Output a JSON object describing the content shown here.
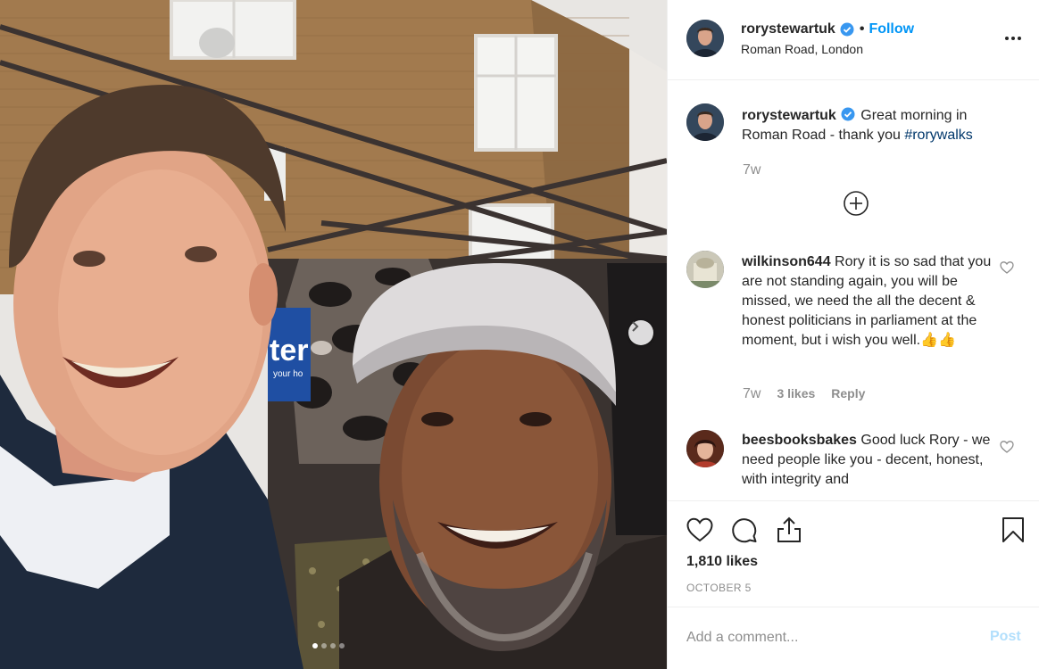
{
  "photo": {
    "alt_dots": 4,
    "active_dot": 0,
    "next_icon": "chevron-right-icon",
    "sign_text": "ter",
    "sign_subtext": "your ho"
  },
  "header": {
    "username": "rorystewartuk",
    "verified_icon": "verified-badge-icon",
    "separator": "•",
    "follow_label": "Follow",
    "location": "Roman Road, London",
    "more_icon": "more-options-icon"
  },
  "caption": {
    "username": "rorystewartuk",
    "text": " Great morning in Roman Road - thank you ",
    "hashtag": "#rorywalks",
    "time": "7w",
    "load_more_icon": "plus-circle-icon"
  },
  "comments": [
    {
      "username": "wilkinson644",
      "text": " Rory it is so sad that you are not standing again, you will be missed, we need the all the decent & honest politicians in parliament at the moment, but i wish you well.👍👍",
      "time": "7w",
      "likes": "3 likes",
      "reply": "Reply"
    },
    {
      "username": "beesbooksbakes",
      "text": " Good luck Rory - we need people like you - decent, honest, with integrity and"
    }
  ],
  "actions": {
    "like_icon": "heart-icon",
    "comment_icon": "comment-icon",
    "share_icon": "share-icon",
    "save_icon": "bookmark-icon",
    "likes": "1,810 likes",
    "date": "OCTOBER 5"
  },
  "add_comment": {
    "placeholder": "Add a comment...",
    "post_label": "Post"
  },
  "colors": {
    "accent": "#0095f6",
    "verified": "#3897f0",
    "muted": "#8e8e8e",
    "post_disabled": "#b2dffc",
    "hashtag": "#00376b"
  }
}
